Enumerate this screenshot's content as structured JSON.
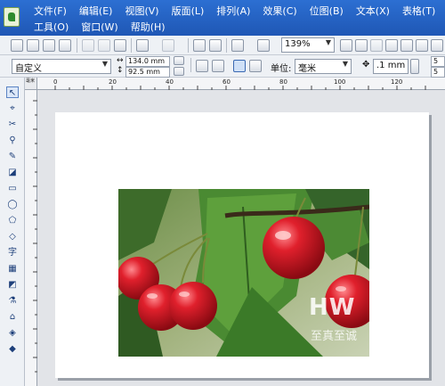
{
  "menubar": {
    "row1": [
      "文件(F)",
      "编辑(E)",
      "视图(V)",
      "版面(L)",
      "排列(A)",
      "效果(C)",
      "位图(B)",
      "文本(X)",
      "表格(T)"
    ],
    "row2": [
      "工具(O)",
      "窗口(W)",
      "帮助(H)"
    ]
  },
  "standard_toolbar": {
    "zoom_value": "139%"
  },
  "property_bar": {
    "page_size": "自定义",
    "width": "134.0 mm",
    "height": "92.5 mm",
    "units_label": "单位:",
    "units_value": "毫米",
    "nudge_value": ".1 mm",
    "dup_x": "5",
    "dup_y": "5"
  },
  "ruler": {
    "top_ticks": [
      "0",
      "20",
      "40",
      "60",
      "80",
      "100",
      "120"
    ],
    "units_marker": "毫米"
  },
  "toolbox": {
    "text_tool": "字"
  },
  "watermark": {
    "main": "HW",
    "sub": "至真至诚"
  },
  "colors": {
    "menubar": "#2a66c8",
    "cherry_red": "#d0141f",
    "leaf_green": "#3f7d2c"
  }
}
